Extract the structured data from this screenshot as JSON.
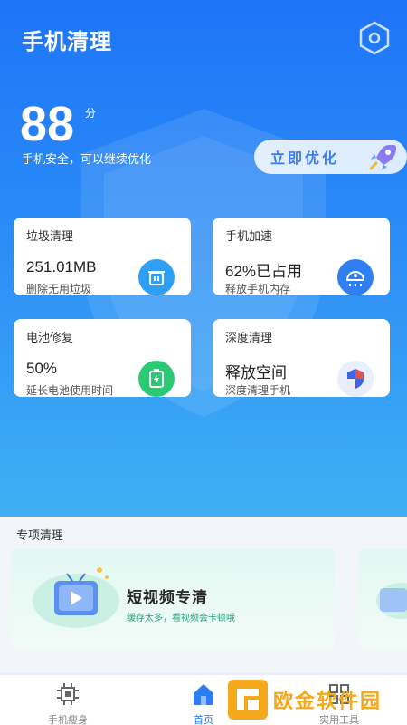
{
  "header": {
    "title": "手机清理",
    "settings_icon": "hexagon-settings-icon"
  },
  "score": {
    "value": "88",
    "unit": "分",
    "description": "手机安全，可以继续优化"
  },
  "optimize_button": {
    "label": "立即优化",
    "icon": "rocket-icon"
  },
  "cards": [
    {
      "title": "垃圾清理",
      "value": "251.01MB",
      "sub": "删除无用垃圾",
      "icon": "trash-icon",
      "icon_color": "#2f9ff5"
    },
    {
      "title": "手机加速",
      "value": "62%已占用",
      "sub": "释放手机内存",
      "icon": "speed-icon",
      "icon_color": "#2f7ff2"
    },
    {
      "title": "电池修复",
      "value": "50%",
      "sub": "延长电池使用时间",
      "icon": "battery-icon",
      "icon_color": "#2cc874"
    },
    {
      "title": "深度清理",
      "value": "释放空间",
      "sub": "深度清理手机",
      "icon": "shield-icon",
      "icon_color": "#3f63e8"
    }
  ],
  "special": {
    "title": "专项清理",
    "items": [
      {
        "title": "短视频专清",
        "sub": "缓存太多，看视频会卡顿哦",
        "icon": "tv-play-icon"
      }
    ]
  },
  "tabbar": {
    "tabs": [
      {
        "label": "手机瘦身",
        "icon": "chip-icon",
        "active": false
      },
      {
        "label": "首页",
        "icon": "home-icon",
        "active": true
      },
      {
        "label": "实用工具",
        "icon": "tools-icon",
        "active": false
      }
    ]
  },
  "watermark": {
    "text": "欧金软件园"
  },
  "colors": {
    "primary": "#1e74f7",
    "accent_green": "#2aa178"
  }
}
